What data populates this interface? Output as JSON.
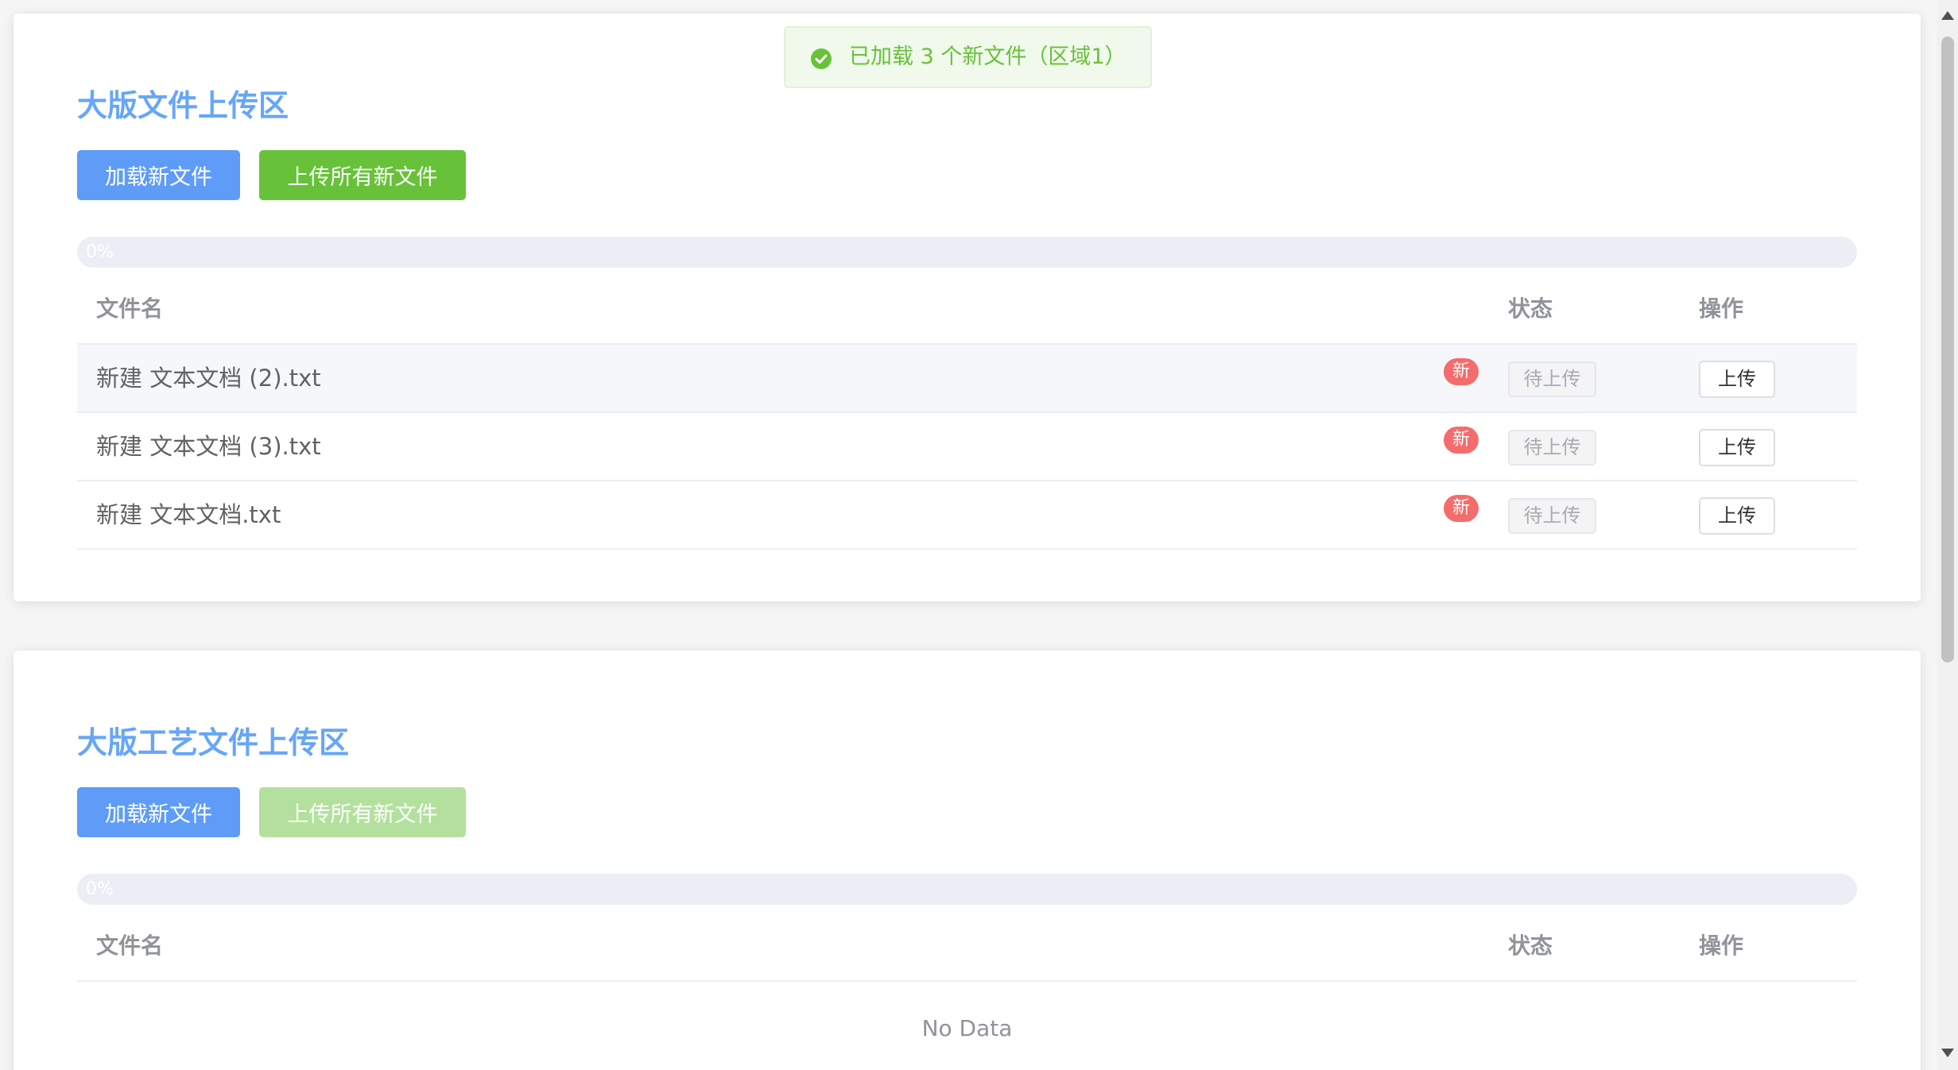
{
  "toast": {
    "icon": "check-circle-icon",
    "message": "已加载 3 个新文件（区域1）",
    "color": "#67c23a"
  },
  "sections": [
    {
      "title": "大版文件上传区",
      "load_button": "加载新文件",
      "upload_all_button": "上传所有新文件",
      "upload_all_disabled": false,
      "progress_text": "0%",
      "progress_percent": 0,
      "columns": {
        "name": "文件名",
        "status": "状态",
        "action": "操作"
      },
      "files": [
        {
          "name": "新建 文本文档 (2).txt",
          "badge": "新",
          "status": "待上传",
          "action": "上传"
        },
        {
          "name": "新建 文本文档 (3).txt",
          "badge": "新",
          "status": "待上传",
          "action": "上传"
        },
        {
          "name": "新建 文本文档.txt",
          "badge": "新",
          "status": "待上传",
          "action": "上传"
        }
      ]
    },
    {
      "title": "大版工艺文件上传区",
      "load_button": "加载新文件",
      "upload_all_button": "上传所有新文件",
      "upload_all_disabled": true,
      "progress_text": "0%",
      "progress_percent": 0,
      "columns": {
        "name": "文件名",
        "status": "状态",
        "action": "操作"
      },
      "empty_text": "No Data",
      "files": []
    }
  ],
  "colors": {
    "title": "#66a6f8",
    "primary": "#5e9cf7",
    "success": "#67c23a",
    "success_disabled": "#b3e19d",
    "danger_badge": "#f56c6c"
  }
}
